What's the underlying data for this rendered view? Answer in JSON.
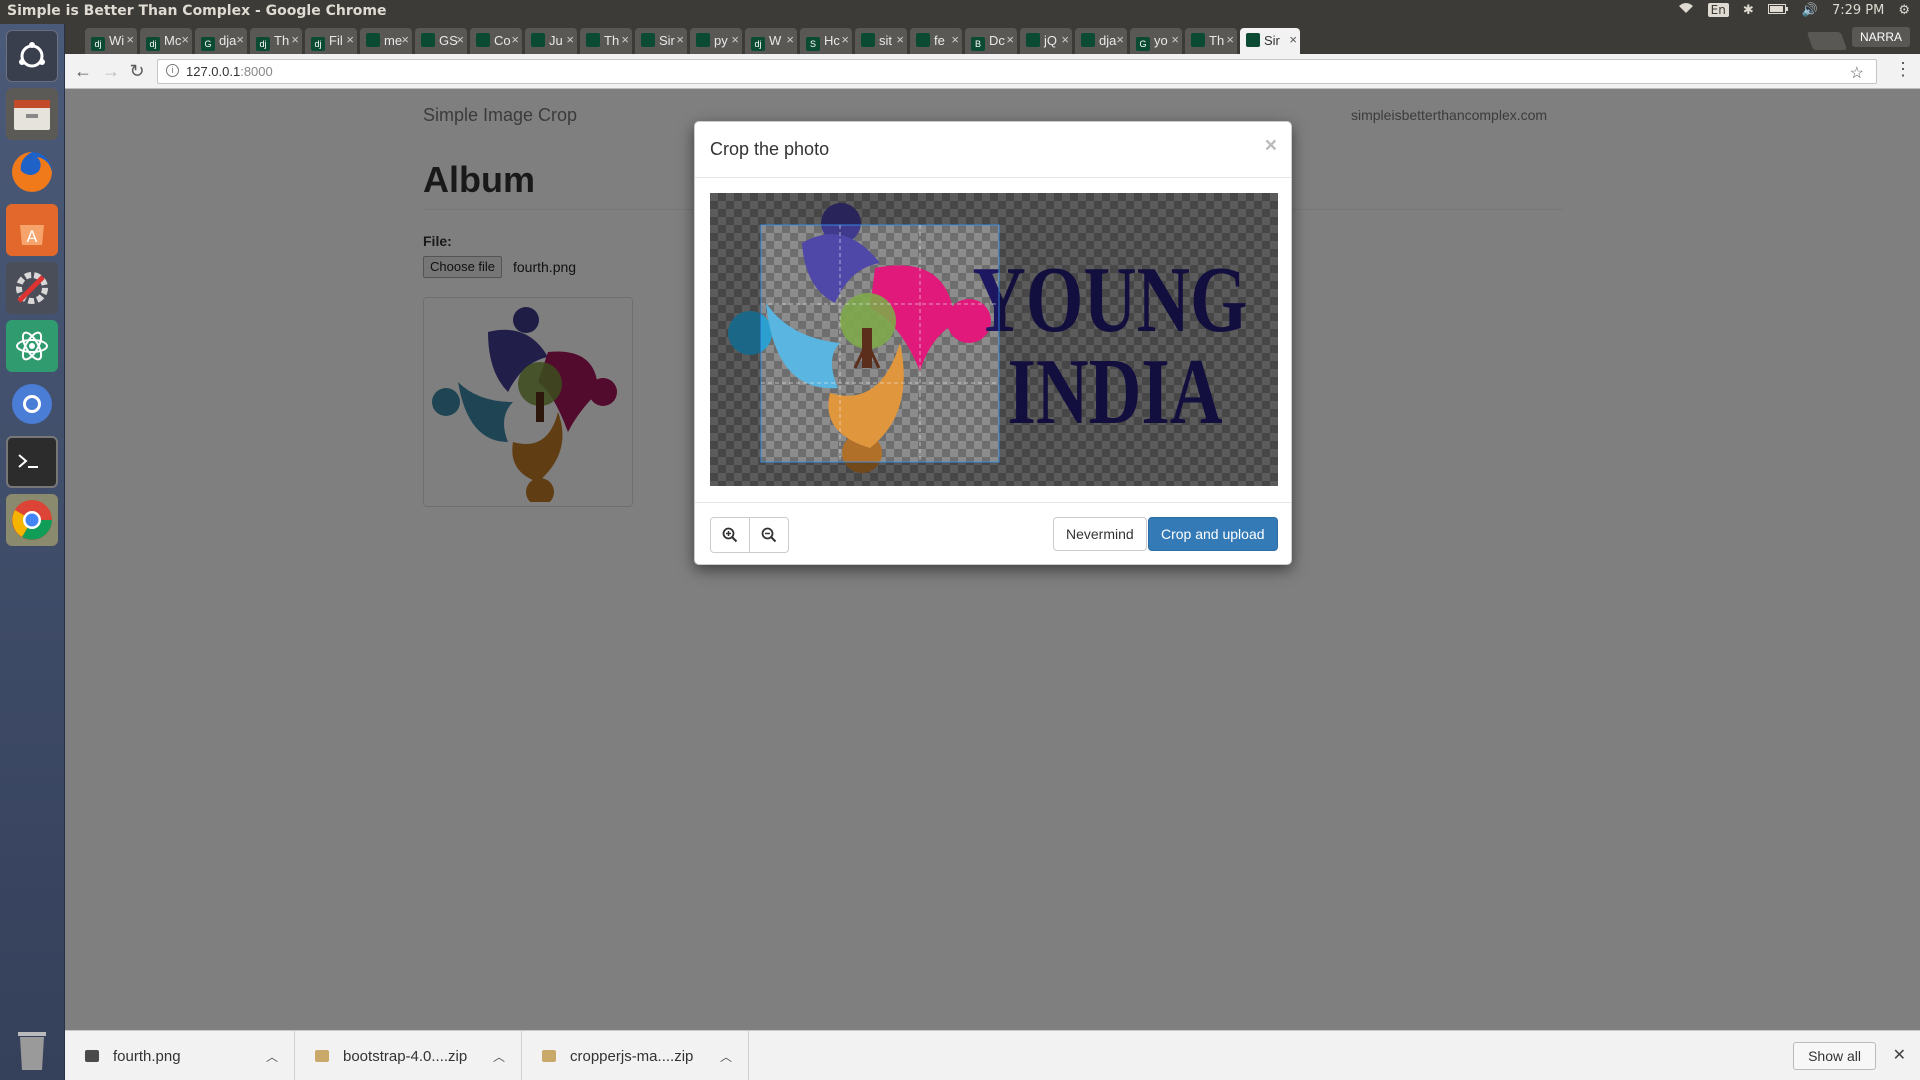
{
  "window": {
    "title": "Simple is Better Than Complex - Google Chrome"
  },
  "system_tray": {
    "lang": "En",
    "time": "7:29 PM"
  },
  "launcher": {
    "items": [
      "ubuntu-dash",
      "files",
      "firefox",
      "software-center",
      "system-settings",
      "atom-editor",
      "chromium",
      "terminal",
      "chrome",
      "trash"
    ]
  },
  "tabs": [
    {
      "label": "Wi",
      "fav": "dj"
    },
    {
      "label": "Mc",
      "fav": "dj"
    },
    {
      "label": "dja",
      "fav": "G"
    },
    {
      "label": "Th",
      "fav": "dj"
    },
    {
      "label": "Fil",
      "fav": "dj"
    },
    {
      "label": "me",
      "fav": "gh"
    },
    {
      "label": "GS",
      "fav": "doc"
    },
    {
      "label": "Co",
      "fav": "doc"
    },
    {
      "label": "Ju",
      "fav": "gh"
    },
    {
      "label": "Th",
      "fav": "dots"
    },
    {
      "label": "Sir",
      "fav": "page"
    },
    {
      "label": "py",
      "fav": "so"
    },
    {
      "label": "W",
      "fav": "dj"
    },
    {
      "label": "Hc",
      "fav": "S"
    },
    {
      "label": "sit",
      "fav": "gh"
    },
    {
      "label": "fe",
      "fav": "gh"
    },
    {
      "label": "Dc",
      "fav": "B"
    },
    {
      "label": "jQ",
      "fav": "page"
    },
    {
      "label": "dja",
      "fav": "so"
    },
    {
      "label": "yo",
      "fav": "G"
    },
    {
      "label": "Th",
      "fav": "gh"
    },
    {
      "label": "Sir",
      "fav": "page",
      "active": true
    }
  ],
  "profile": "NARRA",
  "address_bar": {
    "host": "127.0.0.1",
    "port": ":8000"
  },
  "page": {
    "brand": "Simple Image Crop",
    "site_link": "simpleisbetterthancomplex.com",
    "heading": "Album",
    "file_label": "File:",
    "file_button": "Choose file",
    "file_name": "fourth.png"
  },
  "modal": {
    "title": "Crop the photo",
    "close": "×",
    "logo_text_line1": "YOUNG",
    "logo_text_line2": "INDIA",
    "zoom_in_icon": "zoom-in-icon",
    "zoom_out_icon": "zoom-out-icon",
    "cancel_label": "Nevermind",
    "submit_label": "Crop and upload",
    "colors": {
      "primary": "#337ab7",
      "logo_text": "#1d1660"
    }
  },
  "downloads": {
    "items": [
      {
        "name": "fourth.png",
        "type": "image"
      },
      {
        "name": "bootstrap-4.0....zip",
        "type": "zip"
      },
      {
        "name": "cropperjs-ma....zip",
        "type": "zip"
      }
    ],
    "show_all": "Show all"
  }
}
